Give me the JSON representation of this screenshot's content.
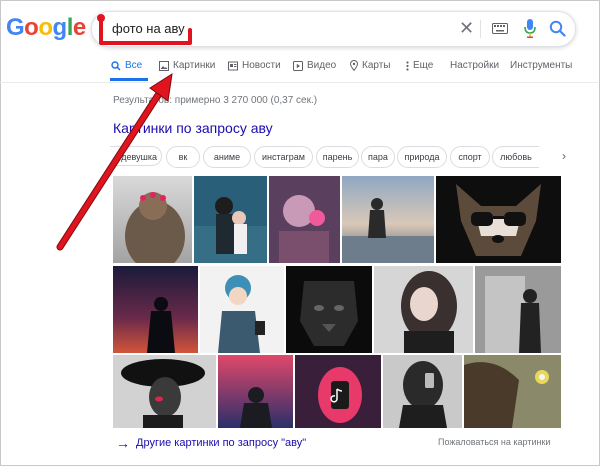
{
  "logo": {
    "letters": [
      {
        "ch": "G",
        "color": "#4285f4"
      },
      {
        "ch": "o",
        "color": "#ea4335"
      },
      {
        "ch": "o",
        "color": "#fbbc05"
      },
      {
        "ch": "g",
        "color": "#4285f4"
      },
      {
        "ch": "l",
        "color": "#34a853"
      },
      {
        "ch": "e",
        "color": "#ea4335"
      }
    ]
  },
  "search": {
    "query": "фото на аву",
    "clear_icon": "close-icon",
    "keyboard_icon": "keyboard-icon",
    "mic_icon": "mic-icon",
    "search_icon": "search-icon"
  },
  "tabs": [
    {
      "label": "Все",
      "icon": "search-icon",
      "active": true
    },
    {
      "label": "Картинки",
      "icon": "image-icon"
    },
    {
      "label": "Новости",
      "icon": "news-icon"
    },
    {
      "label": "Видео",
      "icon": "play-icon"
    },
    {
      "label": "Карты",
      "icon": "pin-icon"
    },
    {
      "label": "Еще",
      "icon": "more-icon"
    },
    {
      "label": "Настройки"
    },
    {
      "label": "Инструменты"
    }
  ],
  "results_stats": "Результатов: примерно 3 270 000 (0,37 сек.)",
  "images_heading": "Картинки по запросу аву",
  "chips": [
    "девушка",
    "вк",
    "аниме",
    "инстаграм",
    "парень",
    "пара",
    "природа",
    "спорт",
    "любовь"
  ],
  "more_link": "Другие картинки по запросу \"аву\"",
  "report_link": "Пожаловаться на картинки",
  "colors": {
    "accent": "#1a73e8",
    "link": "#1a0dab",
    "annotation_arrow": "#e0141e"
  }
}
